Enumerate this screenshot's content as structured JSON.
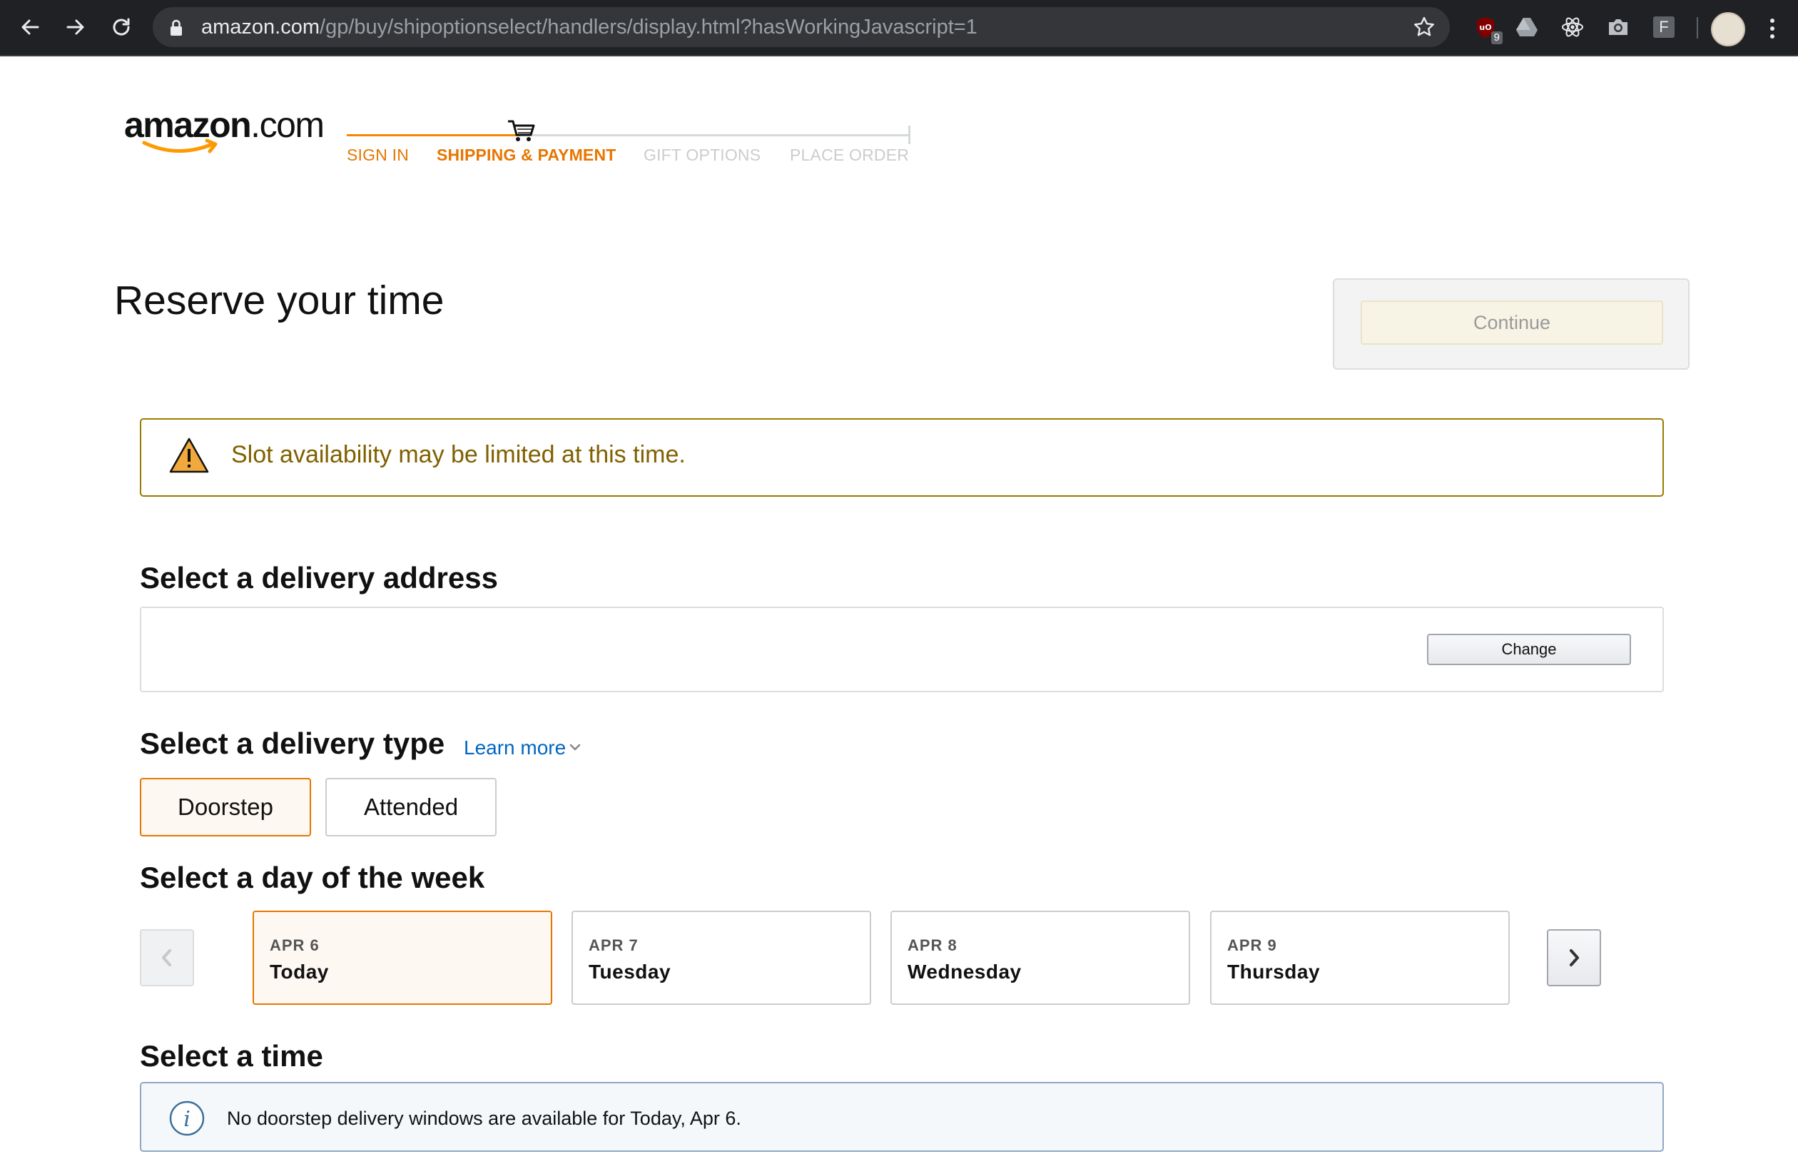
{
  "browser": {
    "url_host": "amazon.com",
    "url_path": "/gp/buy/shipoptionselect/handlers/display.html?hasWorkingJavascript=1",
    "extension_badge": "9",
    "extension_f_label": "F"
  },
  "header": {
    "logo_main": "amazon",
    "logo_suffix": ".com",
    "steps": [
      {
        "label": "SIGN IN",
        "state": "done"
      },
      {
        "label": "SHIPPING & PAYMENT",
        "state": "current"
      },
      {
        "label": "GIFT OPTIONS",
        "state": "todo"
      },
      {
        "label": "PLACE ORDER",
        "state": "todo"
      }
    ]
  },
  "page": {
    "title": "Reserve your time",
    "continue_label": "Continue"
  },
  "alert": {
    "text": "Slot availability may be limited at this time."
  },
  "address": {
    "heading": "Select a delivery address",
    "change_label": "Change"
  },
  "delivery_type": {
    "heading": "Select a delivery type",
    "learn_more": "Learn more",
    "options": [
      {
        "label": "Doorstep",
        "selected": true
      },
      {
        "label": "Attended",
        "selected": false
      }
    ]
  },
  "day": {
    "heading": "Select a day of the week",
    "days": [
      {
        "date": "APR 6",
        "name": "Today",
        "selected": true
      },
      {
        "date": "APR 7",
        "name": "Tuesday",
        "selected": false
      },
      {
        "date": "APR 8",
        "name": "Wednesday",
        "selected": false
      },
      {
        "date": "APR 9",
        "name": "Thursday",
        "selected": false
      }
    ]
  },
  "time": {
    "heading": "Select a time",
    "message": "No doorstep delivery windows are available for Today, Apr 6."
  },
  "colors": {
    "accent_orange": "#e77600",
    "link_blue": "#0066c0",
    "alert_border": "#9b7a00"
  }
}
